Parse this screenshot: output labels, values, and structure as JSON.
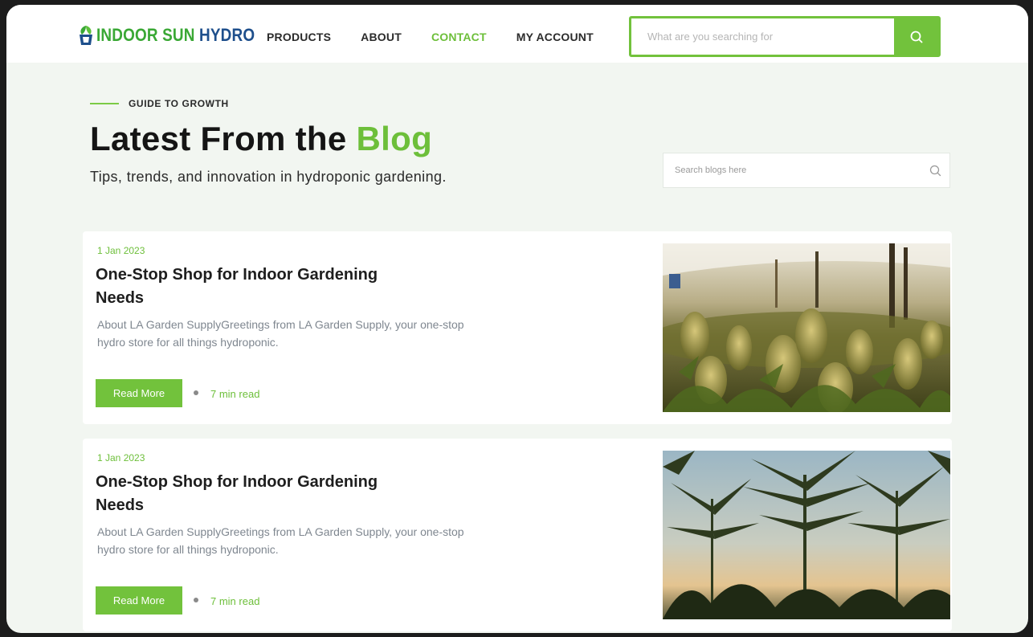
{
  "brand": {
    "logo_part1": "INDOOR SUN",
    "logo_part2": "HYDRO",
    "colors": {
      "accent": "#72c23c",
      "brand_blue": "#1e4f8c",
      "brand_green": "#3aa835"
    }
  },
  "nav": {
    "items": [
      {
        "label": "PRODUCTS",
        "active": false
      },
      {
        "label": "ABOUT",
        "active": false
      },
      {
        "label": "CONTACT",
        "active": true
      },
      {
        "label": "MY ACCOUNT",
        "active": false
      }
    ]
  },
  "search": {
    "placeholder": "What are you searching for",
    "icon": "search-icon"
  },
  "hero": {
    "eyebrow": "GUIDE TO GROWTH",
    "title_prefix": "Latest From the",
    "title_accent": "Blog",
    "subtitle": "Tips, trends, and innovation in hydroponic gardening."
  },
  "blog_search": {
    "placeholder": "Search blogs here",
    "icon": "search-icon"
  },
  "posts": [
    {
      "date": "1 Jan 2023",
      "title": "One-Stop Shop for Indoor Gardening Needs",
      "excerpt": "About LA Garden SupplyGreetings from LA Garden Supply, your one-stop hydro store for all things hydroponic.",
      "button": "Read More",
      "read_time": "7 min read"
    },
    {
      "date": "1 Jan 2023",
      "title": "One-Stop Shop for Indoor Gardening Needs",
      "excerpt": "About LA Garden SupplyGreetings from LA Garden Supply, your one-stop hydro store for all things hydroponic.",
      "button": "Read More",
      "read_time": "7 min read"
    }
  ]
}
